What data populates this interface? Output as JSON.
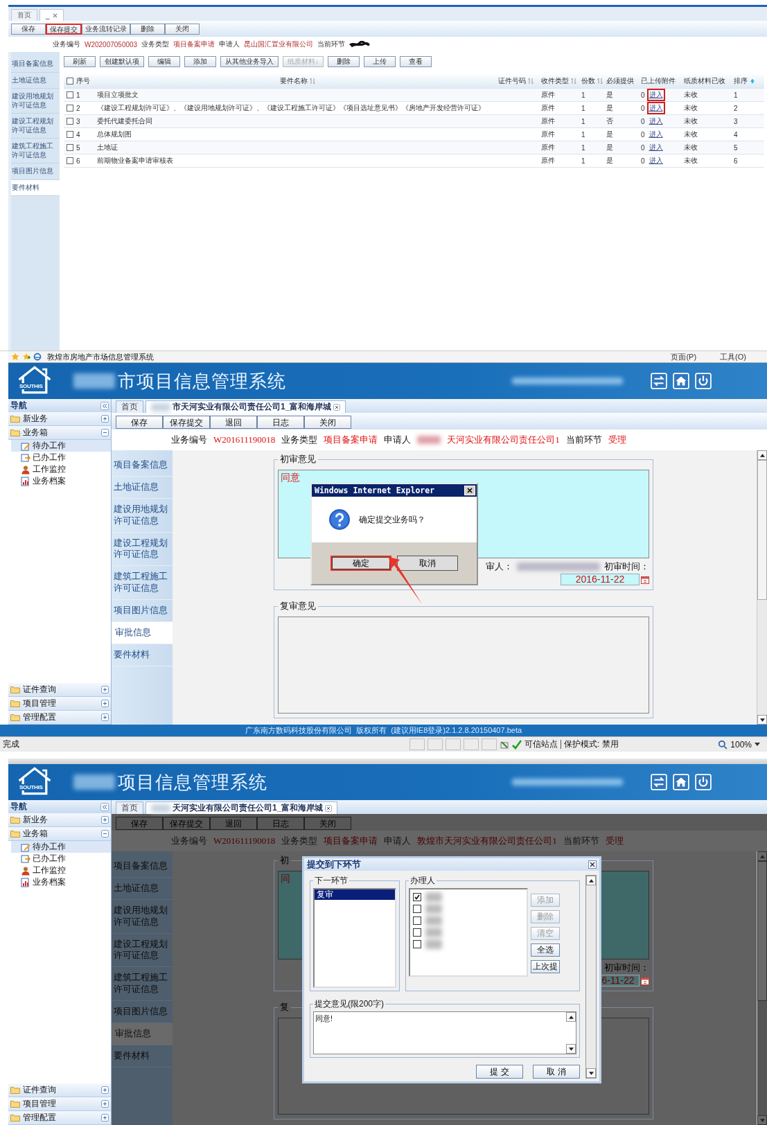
{
  "screens": [
    {
      "kind": "record",
      "tabs": [
        {
          "label": "首页",
          "selected": false
        },
        {
          "label": "_",
          "selected": true
        }
      ],
      "toolbar": [
        {
          "label": "保存",
          "highlighted": false
        },
        {
          "label": "保存提交",
          "highlighted": true
        },
        {
          "label": "业务流转记录",
          "highlighted": false
        },
        {
          "label": "删除",
          "highlighted": false
        },
        {
          "label": "关闭",
          "highlighted": false
        }
      ],
      "info": [
        {
          "label": "业务编号",
          "value": "W202007050003"
        },
        {
          "label": "业务类型",
          "value": "项目备案申请"
        },
        {
          "label": "申请人",
          "value": "昆山国汇置业有限公司"
        },
        {
          "label": "当前环节",
          "redacted": true
        }
      ],
      "side_nav": [
        {
          "label": "项目备案信息",
          "selected": false
        },
        {
          "label": "土地证信息",
          "selected": false
        },
        {
          "label": "建设用地规划许可证信息",
          "selected": false
        },
        {
          "label": "建设工程规划许可证信息",
          "selected": false
        },
        {
          "label": "建筑工程施工许可证信息",
          "selected": false
        },
        {
          "label": "项目图片信息",
          "selected": false
        },
        {
          "label": "要件材料",
          "selected": true
        }
      ],
      "actions": [
        {
          "label": "刷新",
          "disabled": false
        },
        {
          "label": "创建默认项",
          "disabled": false
        },
        {
          "label": "编辑",
          "disabled": false
        },
        {
          "label": "添加",
          "disabled": false
        },
        {
          "label": "从其他业务导入",
          "disabled": false
        },
        {
          "label": "纸质材料↓",
          "disabled": true
        },
        {
          "label": "删除",
          "disabled": false
        },
        {
          "label": "上传",
          "disabled": false
        },
        {
          "label": "查看",
          "disabled": false
        }
      ],
      "table": {
        "header_checked": false,
        "columns": [
          {
            "label": "序号",
            "sortable": false,
            "sorted_ascending": false
          },
          {
            "label": "要件名称",
            "sortable": true,
            "sorted_ascending": false
          },
          {
            "label": "证件号码",
            "sortable": true,
            "sorted_ascending": false
          },
          {
            "label": "收件类型",
            "sortable": true,
            "sorted_ascending": false
          },
          {
            "label": "份数",
            "sortable": true,
            "sorted_ascending": false
          },
          {
            "label": "必须提供",
            "sortable": false,
            "sorted_ascending": false
          },
          {
            "label": "已上传附件",
            "sortable": false,
            "sorted_ascending": false
          },
          {
            "label": "纸质材料已收",
            "sortable": false,
            "sorted_ascending": false
          },
          {
            "label": "排序",
            "sortable": false,
            "sorted_ascending": true
          }
        ],
        "rows": [
          {
            "checked": false,
            "seq": "1",
            "name": "项目立项批文",
            "type": "原件",
            "copies": "1",
            "required": "是",
            "uploaded": "0",
            "link": "进入",
            "highlighted": true,
            "paper": "未收",
            "order": "1"
          },
          {
            "checked": false,
            "seq": "2",
            "name": "《建设工程规划许可证》、《建设用地规划许可证》、《建设工程施工许可证》《项目选址意见书》《房地产开发经营许可证》",
            "type": "原件",
            "copies": "1",
            "required": "是",
            "uploaded": "0",
            "link": "进入",
            "highlighted": true,
            "paper": "未收",
            "order": "2"
          },
          {
            "checked": false,
            "seq": "3",
            "name": "委托代建委托合同",
            "type": "原件",
            "copies": "1",
            "required": "否",
            "uploaded": "0",
            "link": "进入",
            "highlighted": false,
            "paper": "未收",
            "order": "3"
          },
          {
            "checked": false,
            "seq": "4",
            "name": "总体规划图",
            "type": "原件",
            "copies": "1",
            "required": "是",
            "uploaded": "0",
            "link": "进入",
            "highlighted": false,
            "paper": "未收",
            "order": "4"
          },
          {
            "checked": false,
            "seq": "5",
            "name": "土地证",
            "type": "原件",
            "copies": "1",
            "required": "是",
            "uploaded": "0",
            "link": "进入",
            "highlighted": false,
            "paper": "未收",
            "order": "5"
          },
          {
            "checked": false,
            "seq": "6",
            "name": "前期物业备案申请审核表",
            "type": "原件",
            "copies": "1",
            "required": "是",
            "uploaded": "0",
            "link": "进入",
            "highlighted": false,
            "paper": "未收",
            "order": "6"
          }
        ]
      }
    },
    {
      "kind": "confirm",
      "modal_mask": false,
      "browser": {
        "title": "敦煌市房地产市场信息管理系统",
        "menus": [
          "页面(P)",
          "工具(O)"
        ]
      },
      "header": {
        "logo_text": "SOUTHIS",
        "title": "市项目信息管理系统",
        "blurred": true
      },
      "nav": {
        "title": "导航",
        "groups": [
          {
            "label": "新业务",
            "expanded": false
          },
          {
            "label": "业务箱",
            "expanded": true,
            "children": [
              {
                "label": "待办工作",
                "selected": true
              },
              {
                "label": "已办工作",
                "selected": false
              },
              {
                "label": "工作监控",
                "selected": false
              },
              {
                "label": "业务档案",
                "selected": false
              }
            ]
          }
        ],
        "bottom_groups": [
          {
            "label": "证件查询",
            "expanded": false
          },
          {
            "label": "项目管理",
            "expanded": false
          },
          {
            "label": "管理配置",
            "expanded": false
          }
        ]
      },
      "tabs": [
        {
          "label": "首页",
          "selected": false
        },
        {
          "label": "市天河实业有限公司责任公司1_富和海岸城",
          "selected": true,
          "blurred": true
        }
      ],
      "toolbar": [
        "保存",
        "保存提交",
        "退回",
        "日志",
        "关闭"
      ],
      "info": [
        {
          "label": "业务编号",
          "value": "W201611190018"
        },
        {
          "label": "业务类型",
          "value": "项目备案申请"
        },
        {
          "label": "申请人",
          "value": "天河实业有限公司责任公司1",
          "blurred": true
        },
        {
          "label": "当前环节",
          "value": "受理"
        }
      ],
      "side_nav": [
        {
          "label": "项目备案信息",
          "selected": false
        },
        {
          "label": "土地证信息",
          "selected": false
        },
        {
          "label": "建设用地规划许可证信息",
          "selected": false
        },
        {
          "label": "建设工程规划许可证信息",
          "selected": false
        },
        {
          "label": "建筑工程施工许可证信息",
          "selected": false
        },
        {
          "label": "项目图片信息",
          "selected": false
        },
        {
          "label": "审批信息",
          "selected": true
        },
        {
          "label": "要件材料",
          "selected": false
        }
      ],
      "first_review": {
        "legend": "初审意见",
        "opinion": "同意",
        "reviewer_label": "审人：",
        "reviewer_blurred": true,
        "time_label": "初审时间：",
        "date": "2016-11-22"
      },
      "second_review": {
        "legend": "复审意见"
      },
      "dialog": {
        "title": "Windows Internet Explorer",
        "message": "确定提交业务吗？",
        "buttons": [
          {
            "label": "确定",
            "highlighted": true
          },
          {
            "label": "取消",
            "highlighted": false
          }
        ]
      },
      "footer": "广东南方数码科技股份有限公司  版权所有  (建议用IE8登录)2.1.2.8.20150407.beta",
      "status_bar": {
        "status": "完成",
        "zone": "可信站点",
        "protected_mode": "保护模式: 禁用",
        "zoom": "100%"
      }
    },
    {
      "kind": "submit",
      "modal_mask": true,
      "header": {
        "logo_text": "SOUTHIS",
        "title": "项目信息管理系统",
        "blurred": true
      },
      "nav": {
        "title": "导航",
        "groups": [
          {
            "label": "新业务",
            "expanded": false
          },
          {
            "label": "业务箱",
            "expanded": true,
            "children": [
              {
                "label": "待办工作",
                "selected": true
              },
              {
                "label": "已办工作",
                "selected": false
              },
              {
                "label": "工作监控",
                "selected": false
              },
              {
                "label": "业务档案",
                "selected": false
              }
            ]
          }
        ],
        "bottom_groups": [
          {
            "label": "证件查询",
            "expanded": false
          },
          {
            "label": "项目管理",
            "expanded": false
          },
          {
            "label": "管理配置",
            "expanded": false
          }
        ]
      },
      "tabs": [
        {
          "label": "首页",
          "selected": false
        },
        {
          "label": "天河实业有限公司责任公司1_富和海岸城",
          "selected": true,
          "blurred": true
        }
      ],
      "toolbar": [
        "保存",
        "保存提交",
        "退回",
        "日志",
        "关闭"
      ],
      "info": [
        {
          "label": "业务编号",
          "value": "W201611190018"
        },
        {
          "label": "业务类型",
          "value": "项目备案申请"
        },
        {
          "label": "申请人",
          "value": "敦煌市天河实业有限公司责任公司1"
        },
        {
          "label": "当前环节",
          "value": "受理"
        }
      ],
      "side_nav": [
        {
          "label": "项目备案信息",
          "selected": false
        },
        {
          "label": "土地证信息",
          "selected": false
        },
        {
          "label": "建设用地规划许可证信息",
          "selected": false
        },
        {
          "label": "建设工程规划许可证信息",
          "selected": false
        },
        {
          "label": "建筑工程施工许可证信息",
          "selected": false
        },
        {
          "label": "项目图片信息",
          "selected": false
        },
        {
          "label": "审批信息",
          "selected": true
        },
        {
          "label": "要件材料",
          "selected": false
        }
      ],
      "behind": {
        "first_legend": "初",
        "opinion": "同",
        "time_label": "初审时间：",
        "date": "6-11-22",
        "second_legend": "复"
      },
      "submit_dialog": {
        "title": "提交到下环节",
        "next_step": {
          "legend": "下一环节",
          "options": [
            {
              "label": "复审",
              "selected": true
            }
          ]
        },
        "handlers": {
          "legend": "办理人",
          "rows": [
            {
              "checked": true
            },
            {
              "checked": false
            },
            {
              "checked": false
            },
            {
              "checked": false
            },
            {
              "checked": false
            }
          ],
          "buttons": [
            {
              "label": "添加",
              "disabled": true
            },
            {
              "label": "删除",
              "disabled": true
            },
            {
              "label": "清空",
              "disabled": true
            },
            {
              "label": "全选",
              "disabled": false
            },
            {
              "label": "上次提",
              "disabled": false
            }
          ]
        },
        "comment": {
          "legend": "提交意见(限200字)",
          "value": "同意!"
        },
        "buttons": [
          "提 交",
          "取 消"
        ]
      }
    }
  ]
}
